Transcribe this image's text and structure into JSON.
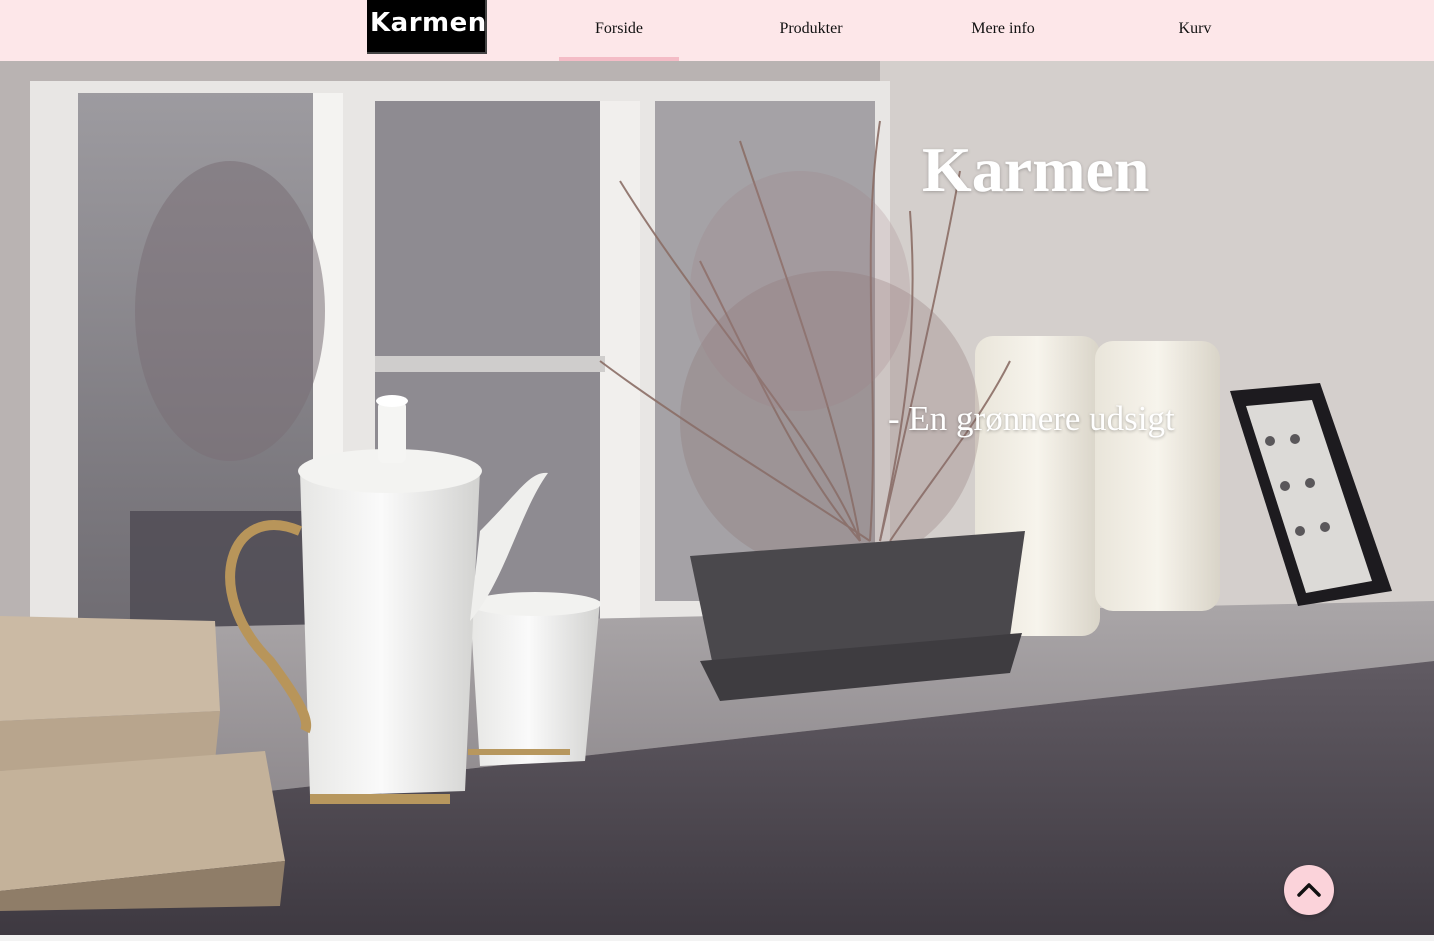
{
  "brand": {
    "logo_text": "Karmen"
  },
  "nav": {
    "items": [
      {
        "label": "Forside",
        "active": true
      },
      {
        "label": "Produkter",
        "active": false
      },
      {
        "label": "Mere info",
        "active": false
      },
      {
        "label": "Kurv",
        "active": false
      }
    ]
  },
  "hero": {
    "title": "Karmen",
    "subtitle": "- En grønnere udsigt"
  },
  "colors": {
    "navbar_bg": "#fde7e9",
    "active_underline": "#f4bcc6",
    "scroll_button_bg": "#fbd3da",
    "hero_text": "#ffffff"
  },
  "icons": {
    "scroll_top": "chevron-up-icon"
  }
}
